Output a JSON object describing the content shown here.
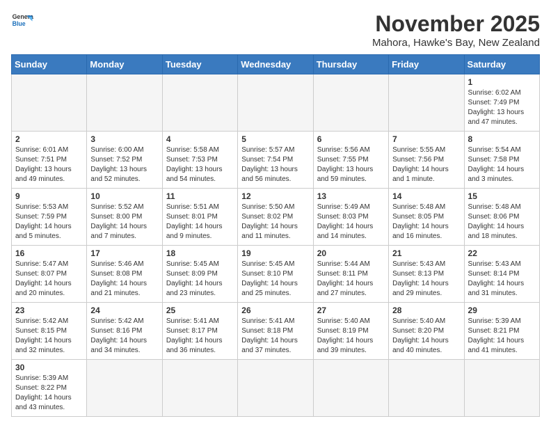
{
  "header": {
    "logo_line1": "General",
    "logo_line2": "Blue",
    "month": "November 2025",
    "location": "Mahora, Hawke's Bay, New Zealand"
  },
  "weekdays": [
    "Sunday",
    "Monday",
    "Tuesday",
    "Wednesday",
    "Thursday",
    "Friday",
    "Saturday"
  ],
  "weeks": [
    [
      {
        "day": "",
        "info": ""
      },
      {
        "day": "",
        "info": ""
      },
      {
        "day": "",
        "info": ""
      },
      {
        "day": "",
        "info": ""
      },
      {
        "day": "",
        "info": ""
      },
      {
        "day": "",
        "info": ""
      },
      {
        "day": "1",
        "info": "Sunrise: 6:02 AM\nSunset: 7:49 PM\nDaylight: 13 hours and 47 minutes."
      }
    ],
    [
      {
        "day": "2",
        "info": "Sunrise: 6:01 AM\nSunset: 7:51 PM\nDaylight: 13 hours and 49 minutes."
      },
      {
        "day": "3",
        "info": "Sunrise: 6:00 AM\nSunset: 7:52 PM\nDaylight: 13 hours and 52 minutes."
      },
      {
        "day": "4",
        "info": "Sunrise: 5:58 AM\nSunset: 7:53 PM\nDaylight: 13 hours and 54 minutes."
      },
      {
        "day": "5",
        "info": "Sunrise: 5:57 AM\nSunset: 7:54 PM\nDaylight: 13 hours and 56 minutes."
      },
      {
        "day": "6",
        "info": "Sunrise: 5:56 AM\nSunset: 7:55 PM\nDaylight: 13 hours and 59 minutes."
      },
      {
        "day": "7",
        "info": "Sunrise: 5:55 AM\nSunset: 7:56 PM\nDaylight: 14 hours and 1 minute."
      },
      {
        "day": "8",
        "info": "Sunrise: 5:54 AM\nSunset: 7:58 PM\nDaylight: 14 hours and 3 minutes."
      }
    ],
    [
      {
        "day": "9",
        "info": "Sunrise: 5:53 AM\nSunset: 7:59 PM\nDaylight: 14 hours and 5 minutes."
      },
      {
        "day": "10",
        "info": "Sunrise: 5:52 AM\nSunset: 8:00 PM\nDaylight: 14 hours and 7 minutes."
      },
      {
        "day": "11",
        "info": "Sunrise: 5:51 AM\nSunset: 8:01 PM\nDaylight: 14 hours and 9 minutes."
      },
      {
        "day": "12",
        "info": "Sunrise: 5:50 AM\nSunset: 8:02 PM\nDaylight: 14 hours and 11 minutes."
      },
      {
        "day": "13",
        "info": "Sunrise: 5:49 AM\nSunset: 8:03 PM\nDaylight: 14 hours and 14 minutes."
      },
      {
        "day": "14",
        "info": "Sunrise: 5:48 AM\nSunset: 8:05 PM\nDaylight: 14 hours and 16 minutes."
      },
      {
        "day": "15",
        "info": "Sunrise: 5:48 AM\nSunset: 8:06 PM\nDaylight: 14 hours and 18 minutes."
      }
    ],
    [
      {
        "day": "16",
        "info": "Sunrise: 5:47 AM\nSunset: 8:07 PM\nDaylight: 14 hours and 20 minutes."
      },
      {
        "day": "17",
        "info": "Sunrise: 5:46 AM\nSunset: 8:08 PM\nDaylight: 14 hours and 21 minutes."
      },
      {
        "day": "18",
        "info": "Sunrise: 5:45 AM\nSunset: 8:09 PM\nDaylight: 14 hours and 23 minutes."
      },
      {
        "day": "19",
        "info": "Sunrise: 5:45 AM\nSunset: 8:10 PM\nDaylight: 14 hours and 25 minutes."
      },
      {
        "day": "20",
        "info": "Sunrise: 5:44 AM\nSunset: 8:11 PM\nDaylight: 14 hours and 27 minutes."
      },
      {
        "day": "21",
        "info": "Sunrise: 5:43 AM\nSunset: 8:13 PM\nDaylight: 14 hours and 29 minutes."
      },
      {
        "day": "22",
        "info": "Sunrise: 5:43 AM\nSunset: 8:14 PM\nDaylight: 14 hours and 31 minutes."
      }
    ],
    [
      {
        "day": "23",
        "info": "Sunrise: 5:42 AM\nSunset: 8:15 PM\nDaylight: 14 hours and 32 minutes."
      },
      {
        "day": "24",
        "info": "Sunrise: 5:42 AM\nSunset: 8:16 PM\nDaylight: 14 hours and 34 minutes."
      },
      {
        "day": "25",
        "info": "Sunrise: 5:41 AM\nSunset: 8:17 PM\nDaylight: 14 hours and 36 minutes."
      },
      {
        "day": "26",
        "info": "Sunrise: 5:41 AM\nSunset: 8:18 PM\nDaylight: 14 hours and 37 minutes."
      },
      {
        "day": "27",
        "info": "Sunrise: 5:40 AM\nSunset: 8:19 PM\nDaylight: 14 hours and 39 minutes."
      },
      {
        "day": "28",
        "info": "Sunrise: 5:40 AM\nSunset: 8:20 PM\nDaylight: 14 hours and 40 minutes."
      },
      {
        "day": "29",
        "info": "Sunrise: 5:39 AM\nSunset: 8:21 PM\nDaylight: 14 hours and 41 minutes."
      }
    ],
    [
      {
        "day": "30",
        "info": "Sunrise: 5:39 AM\nSunset: 8:22 PM\nDaylight: 14 hours and 43 minutes."
      },
      {
        "day": "",
        "info": ""
      },
      {
        "day": "",
        "info": ""
      },
      {
        "day": "",
        "info": ""
      },
      {
        "day": "",
        "info": ""
      },
      {
        "day": "",
        "info": ""
      },
      {
        "day": "",
        "info": ""
      }
    ]
  ]
}
